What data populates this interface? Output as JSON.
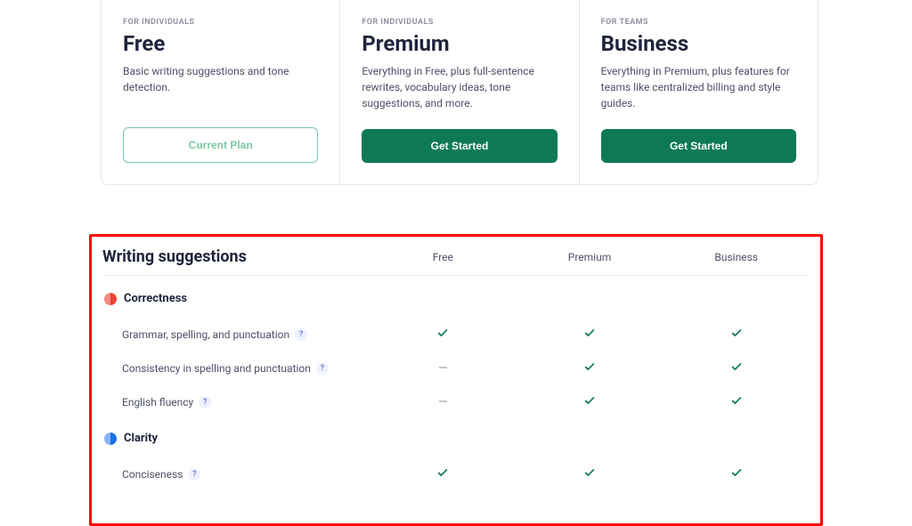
{
  "plans": [
    {
      "eyebrow": "FOR INDIVIDUALS",
      "title": "Free",
      "desc": "Basic writing suggestions and tone detection.",
      "cta": "Current Plan",
      "variant": "outline"
    },
    {
      "eyebrow": "FOR INDIVIDUALS",
      "title": "Premium",
      "desc": "Everything in Free, plus full-sentence rewrites, vocabulary ideas, tone suggestions, and more.",
      "cta": "Get Started",
      "variant": "solid"
    },
    {
      "eyebrow": "FOR TEAMS",
      "title": "Business",
      "desc": "Everything in Premium, plus features for teams like centralized billing and style guides.",
      "cta": "Get Started",
      "variant": "solid"
    }
  ],
  "comparison": {
    "title": "Writing suggestions",
    "columns": [
      "Free",
      "Premium",
      "Business"
    ],
    "sections": [
      {
        "title": "Correctness",
        "icon_color_a": "#f28b82",
        "icon_color_b": "#ea4335",
        "features": [
          {
            "label": "Grammar, spelling, and punctuation",
            "values": [
              "check",
              "check",
              "check"
            ]
          },
          {
            "label": "Consistency in spelling and punctuation",
            "values": [
              "dash",
              "check",
              "check"
            ]
          },
          {
            "label": "English fluency",
            "values": [
              "dash",
              "check",
              "check"
            ]
          }
        ]
      },
      {
        "title": "Clarity",
        "icon_color_a": "#8ab4f8",
        "icon_color_b": "#1a73e8",
        "features": [
          {
            "label": "Conciseness",
            "values": [
              "check",
              "check",
              "check"
            ]
          }
        ]
      }
    ]
  },
  "glyphs": {
    "help": "?",
    "dash": "—"
  }
}
